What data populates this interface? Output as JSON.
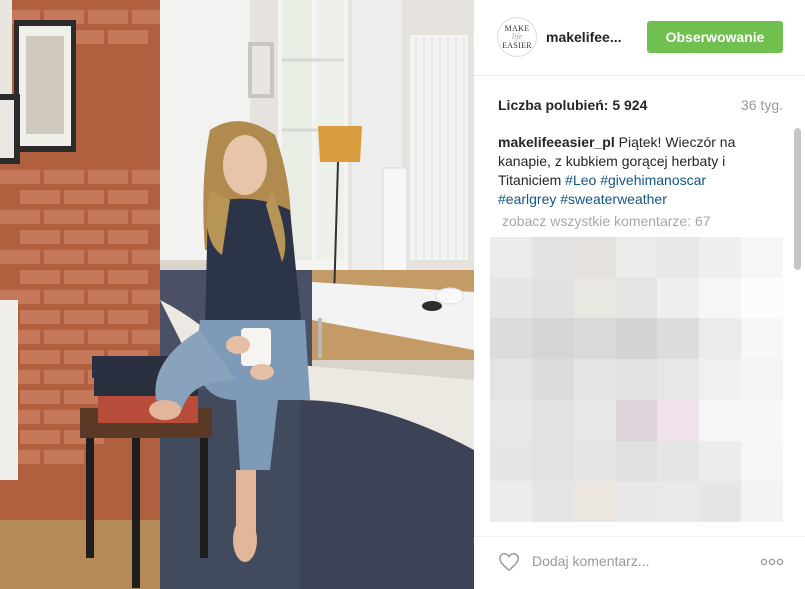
{
  "post": {
    "image_alt": "Woman in navy sweater and jeans sitting on a grey sofa with a white mug, brick wall and window in the background"
  },
  "header": {
    "avatar_line1": "MAKE",
    "avatar_line2": "life",
    "avatar_line3": "EASIER",
    "username": "makelifee...",
    "follow_label": "Obserwowanie"
  },
  "stats": {
    "likes": "Liczba polubień: 5 924",
    "age": "36 tyg."
  },
  "caption": {
    "author": "makelifeeasier_pl",
    "text": " Piątek! Wieczór na kanapie, z kubkiem gorącej herbaty i Titaniciem ",
    "tags": [
      "#Leo",
      "#givehimanoscar",
      "#earlgrey",
      "#sweaterweather"
    ]
  },
  "comments": {
    "view_all": "zobacz wszystkie komentarze: 67"
  },
  "footer": {
    "comment_placeholder": "Dodaj komentarz..."
  },
  "colors": {
    "follow_green": "#70c050",
    "hashtag_blue": "#125688",
    "blur_cells": [
      "#ebebeb",
      "#e3e3e3",
      "#e6e2dd",
      "#ececec",
      "#e8e8e8",
      "#efefef",
      "#f6f6f6",
      "#e6e6e6",
      "#e1e1e1",
      "#e9e7e1",
      "#e4e4e4",
      "#efefef",
      "#f6f6f6",
      "#fcfcfc",
      "#dcdcdc",
      "#d6d6d6",
      "#dadada",
      "#d4d4d4",
      "#dcdcdc",
      "#ebebeb",
      "#f7f7f7",
      "#e4e4e4",
      "#dcdcdc",
      "#e4e4e4",
      "#e2e2e2",
      "#e7e7e7",
      "#f0f0f0",
      "#f4f4f4",
      "#e8e8e8",
      "#e2e2e2",
      "#e7e7e7",
      "#dcd4da",
      "#efe2ec",
      "#f6f6f6",
      "#f8f8f8",
      "#e6e6e6",
      "#e2e2e2",
      "#e6e6e6",
      "#e1e1e1",
      "#e6e6e6",
      "#ececec",
      "#f6f6f6",
      "#ececec",
      "#e5e5e5",
      "#ebe7e0",
      "#e8e8e8",
      "#e9e9e9",
      "#e6e6e6",
      "#f3f3f3"
    ]
  }
}
